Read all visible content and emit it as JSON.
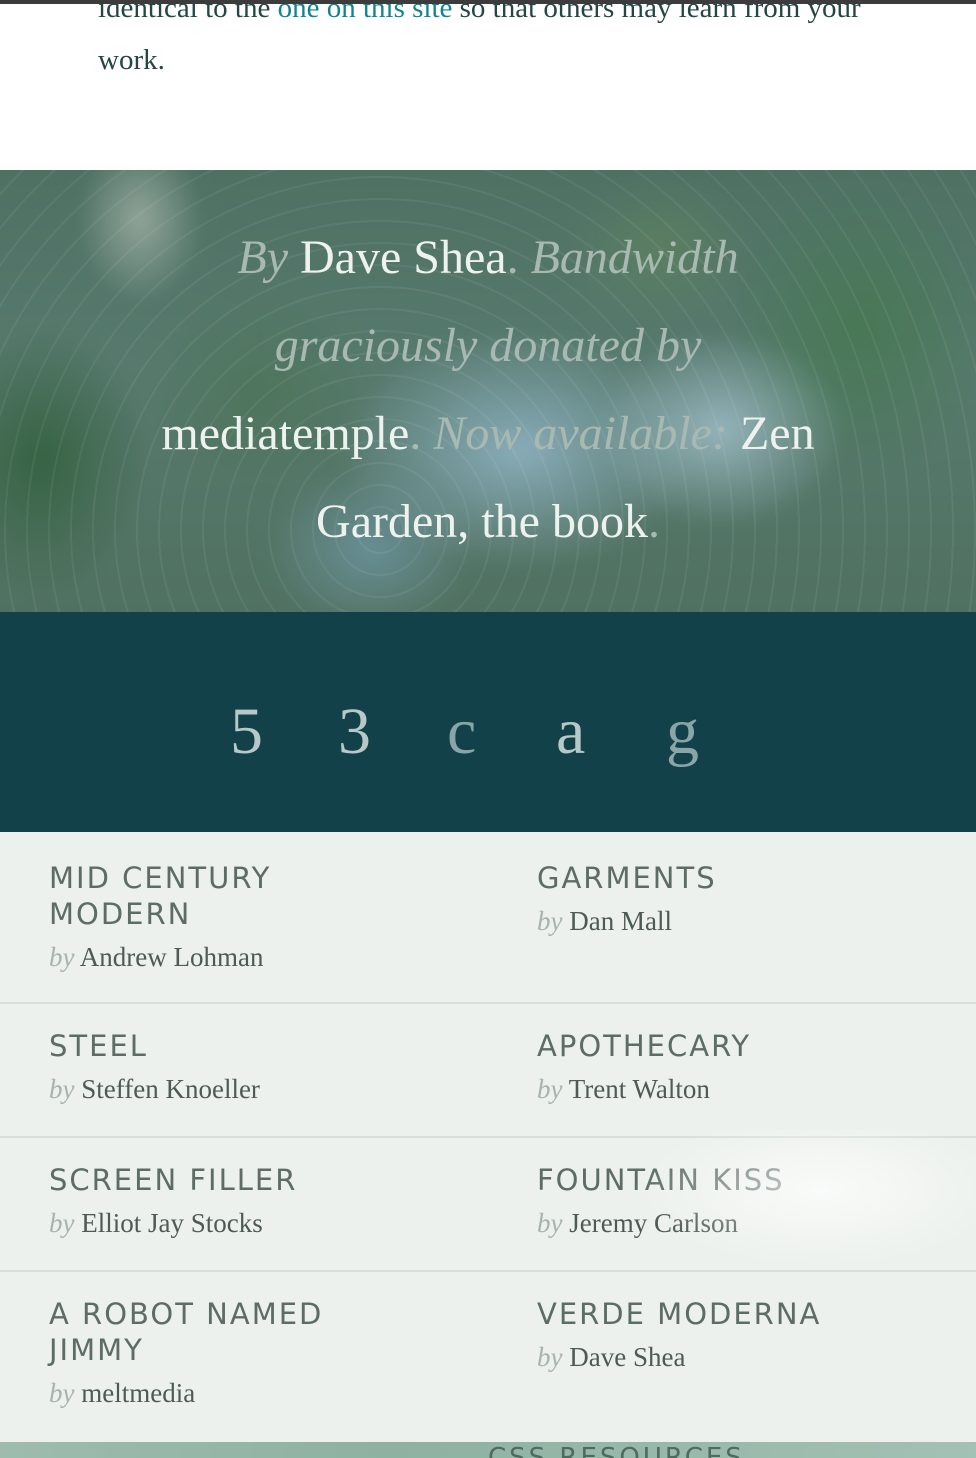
{
  "intro": {
    "text_before": "identical to the ",
    "link": "one on this site",
    "text_after": " so that others may learn from your work."
  },
  "credits": {
    "by": "By",
    "author": "Dave Shea",
    "period1": ".",
    "bandwidth": "Bandwidth graciously donated by",
    "sponsor": "mediatemple",
    "period2": ".",
    "now_available": "Now available:",
    "book": "Zen Garden, the book",
    "period3": "."
  },
  "nav_letters": [
    "5",
    "3",
    "c",
    "a",
    "g"
  ],
  "designs": [
    {
      "left": {
        "name": "MID CENTURY MODERN",
        "by": "by",
        "author": "Andrew Lohman"
      },
      "right": {
        "name": "GARMENTS",
        "by": "by",
        "author": "Dan Mall"
      }
    },
    {
      "left": {
        "name": "STEEL",
        "by": "by",
        "author": "Steffen Knoeller"
      },
      "right": {
        "name": "APOTHECARY",
        "by": "by",
        "author": "Trent Walton"
      }
    },
    {
      "left": {
        "name": "SCREEN FILLER",
        "by": "by",
        "author": "Elliot Jay Stocks"
      },
      "right": {
        "name": "FOUNTAIN KISS",
        "by": "by",
        "author": "Jeremy Carlson"
      }
    },
    {
      "left": {
        "name": "A ROBOT NAMED JIMMY",
        "by": "by",
        "author": "meltmedia"
      },
      "right": {
        "name": "VERDE MODERNA",
        "by": "by",
        "author": "Dave Shea"
      }
    }
  ],
  "resources_heading": "CSS RESOURCES"
}
